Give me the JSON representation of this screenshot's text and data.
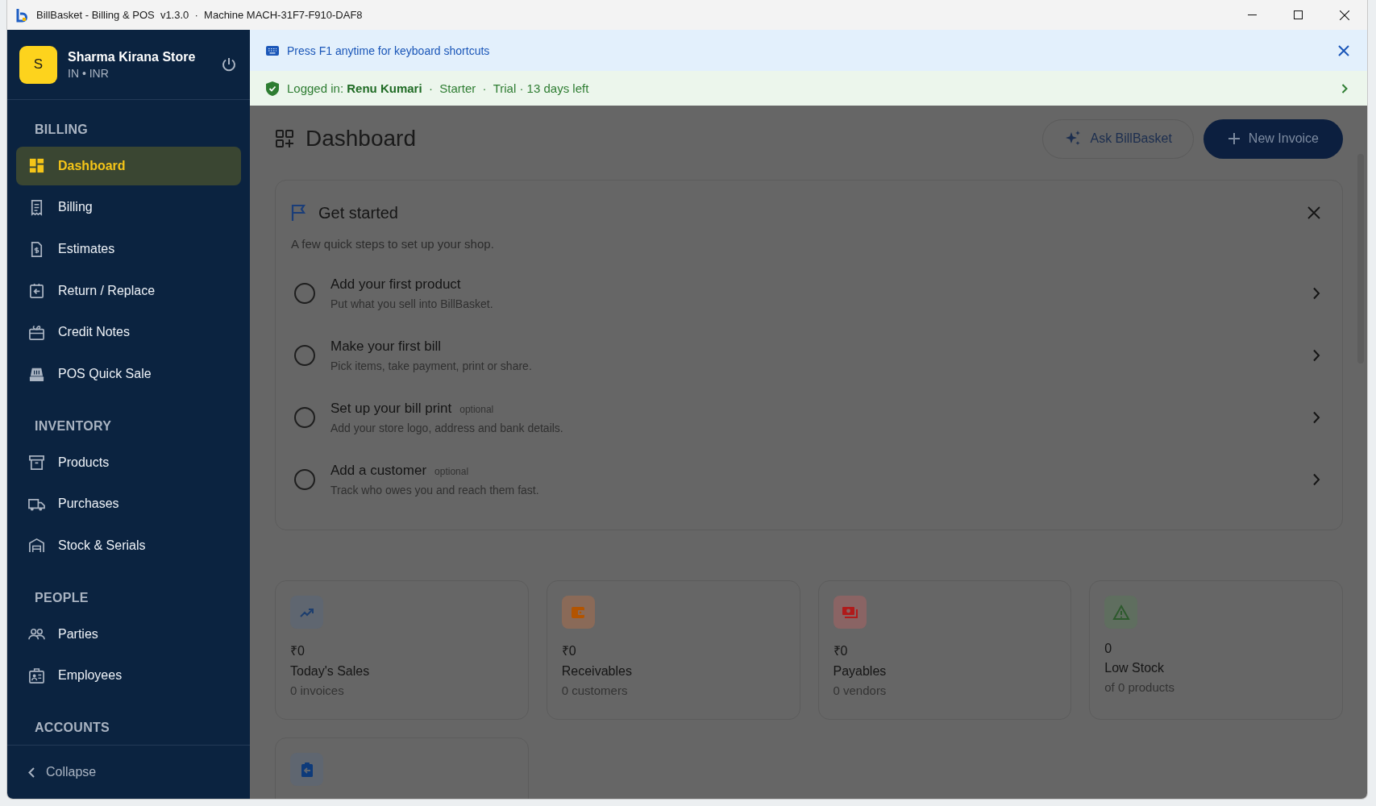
{
  "window": {
    "title": "BillBasket - Billing & POS  v1.3.0  ·  Machine MACH-31F7-F910-DAF8"
  },
  "sidebar": {
    "store": {
      "avatar": "S",
      "name": "Sharma Kirana Store",
      "subtitle": "IN • INR"
    },
    "sections": [
      {
        "heading": "BILLING",
        "items": [
          {
            "label": "Dashboard",
            "selected": true
          },
          {
            "label": "Billing",
            "selected": false
          },
          {
            "label": "Estimates",
            "selected": false
          },
          {
            "label": "Return / Replace",
            "selected": false
          },
          {
            "label": "Credit Notes",
            "selected": false
          },
          {
            "label": "POS Quick Sale",
            "selected": false
          }
        ]
      },
      {
        "heading": "INVENTORY",
        "items": [
          {
            "label": "Products",
            "selected": false
          },
          {
            "label": "Purchases",
            "selected": false
          },
          {
            "label": "Stock & Serials",
            "selected": false
          }
        ]
      },
      {
        "heading": "PEOPLE",
        "items": [
          {
            "label": "Parties",
            "selected": false
          },
          {
            "label": "Employees",
            "selected": false
          }
        ]
      },
      {
        "heading": "ACCOUNTS"
      }
    ],
    "collapse": "Collapse"
  },
  "banners": {
    "shortcut_hint": "Press F1 anytime for keyboard shortcuts",
    "login": "Logged in: **Renu Kumari**  ·  Starter  ·  Trial · 13 days left"
  },
  "header": {
    "title": "Dashboard",
    "buttons": [
      {
        "label": "Ask BillBasket",
        "kind": "secondary"
      },
      {
        "label": "New Invoice",
        "kind": "primary"
      }
    ]
  },
  "get_started": {
    "title": "Get started",
    "subtitle": "A few quick steps to set up your shop.",
    "steps": [
      {
        "title": "Add your first product",
        "description": "Put what you sell into BillBasket.",
        "done": false
      },
      {
        "title": "Make your first bill",
        "description": "Pick items, take payment, print or share.",
        "done": false
      },
      {
        "title": "Set up your bill print",
        "tag": "optional",
        "description": "Add your store logo, address and bank details.",
        "done": false
      },
      {
        "title": "Add a customer",
        "tag": "optional",
        "description": "Track who owes you and reach them fast.",
        "done": false
      }
    ]
  },
  "stats": [
    {
      "value": "₹0",
      "label": "Today's Sales",
      "detail": "0 invoices",
      "color": "#1d3e6e"
    },
    {
      "value": "₹0",
      "label": "Receivables",
      "detail": "0 customers",
      "color": "#b35400"
    },
    {
      "value": "₹0",
      "label": "Payables",
      "detail": "0 vendors",
      "color": "#b01a1a"
    },
    {
      "value": "0",
      "label": "Low Stock",
      "detail": "of 0 products",
      "color": "#2d5a2d"
    },
    {
      "color": "#0d3a7a"
    }
  ]
}
